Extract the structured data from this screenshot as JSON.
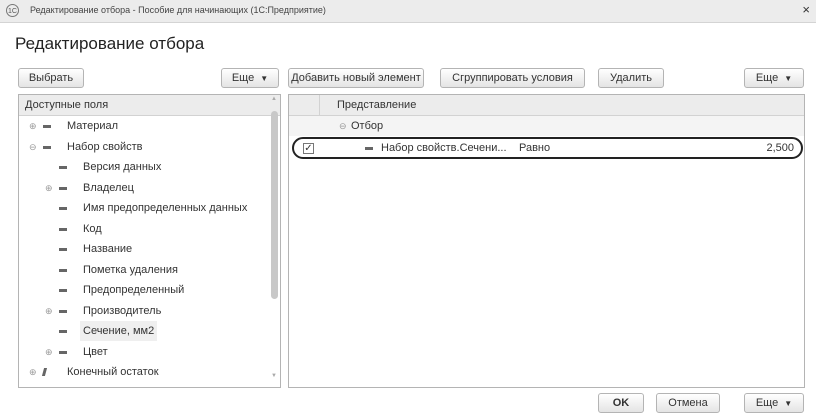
{
  "window": {
    "title": "Редактирование отбора - Пособие для начинающих  (1С:Предприятие)",
    "app_icon_text": "1С",
    "close_glyph": "×"
  },
  "form": {
    "title": "Редактирование отбора"
  },
  "left_toolbar": {
    "select_label": "Выбрать",
    "more_label": "Еще"
  },
  "right_toolbar": {
    "add_label": "Добавить новый элемент",
    "group_label": "Сгруппировать условия",
    "delete_label": "Удалить",
    "more_label": "Еще"
  },
  "fields_panel": {
    "header": "Доступные поля",
    "items": [
      {
        "label": "Материал",
        "expand": "⊕",
        "icon": "dash"
      },
      {
        "label": "Набор свойств",
        "expand": "⊖",
        "icon": "dash"
      },
      {
        "label": "Версия данных",
        "expand": "",
        "icon": "dash"
      },
      {
        "label": "Владелец",
        "expand": "⊕",
        "icon": "dash"
      },
      {
        "label": "Имя предопределенных данных",
        "expand": "",
        "icon": "dash"
      },
      {
        "label": "Код",
        "expand": "",
        "icon": "dash"
      },
      {
        "label": "Название",
        "expand": "",
        "icon": "dash"
      },
      {
        "label": "Пометка удаления",
        "expand": "",
        "icon": "dash"
      },
      {
        "label": "Предопределенный",
        "expand": "",
        "icon": "dash"
      },
      {
        "label": "Производитель",
        "expand": "⊕",
        "icon": "dash"
      },
      {
        "label": "Сечение, мм2",
        "expand": "",
        "icon": "dash",
        "selected": true
      },
      {
        "label": "Цвет",
        "expand": "⊕",
        "icon": "dash"
      },
      {
        "label": "Конечный остаток",
        "expand": "⊕",
        "icon": "resource"
      }
    ]
  },
  "filter_panel": {
    "header": "Представление",
    "group": {
      "label": "Отбор",
      "expand": "⊖"
    },
    "row": {
      "checked": true,
      "check_glyph": "✓",
      "field": "Набор свойств.Сечени...",
      "condition": "Равно",
      "value": "2,500"
    }
  },
  "footer": {
    "ok_label": "OK",
    "cancel_label": "Отмена",
    "more_label": "Еще"
  },
  "colors": {
    "header_bg": "#ececec",
    "border": "#b4b4b4",
    "selected_bg": "#efefef",
    "highlight_oval": "#222222"
  }
}
